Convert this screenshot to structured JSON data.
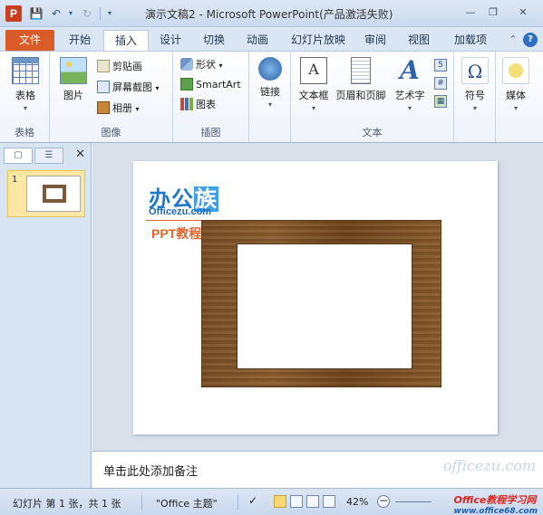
{
  "titlebar": {
    "app_icon": "P",
    "title": "演示文稿2 - Microsoft PowerPoint(产品激活失败)"
  },
  "tabs": [
    "文件",
    "开始",
    "插入",
    "设计",
    "切换",
    "动画",
    "幻灯片放映",
    "审阅",
    "视图",
    "加载项"
  ],
  "active_tab": "插入",
  "ribbon": {
    "groups": {
      "tables": {
        "label": "表格",
        "table_btn": "表格"
      },
      "images": {
        "label": "图像",
        "picture_btn": "图片",
        "clipart": "剪贴画",
        "screenshot": "屏幕截图",
        "album": "相册"
      },
      "illustrations": {
        "label": "插图",
        "shapes": "形状",
        "smartart": "SmartArt",
        "chart": "图表"
      },
      "links": {
        "link_btn": "链接"
      },
      "text": {
        "label": "文本",
        "textbox": "文本框",
        "header_footer": "页眉和页脚",
        "wordart": "艺术字"
      },
      "symbols": {
        "symbol_btn": "符号",
        "symbol_glyph": "Ω"
      },
      "media": {
        "media_btn": "媒体"
      }
    }
  },
  "left_panel": {
    "slide_number": "1"
  },
  "slide": {
    "logo_title_a": "办公",
    "logo_title_b": "族",
    "logo_url": "Officezu.com",
    "logo_sub": "PPT教程"
  },
  "notes": {
    "placeholder": "单击此处添加备注",
    "watermark": "officezu.com"
  },
  "statusbar": {
    "slide_info": "幻灯片 第 1 张，共 1 张",
    "theme": "\"Office 主题\"",
    "zoom": "42%",
    "site_a": "Office教程学习网",
    "site_b": "www.office68.com"
  },
  "colors": {
    "file_tab": "#d95b27",
    "accent": "#2f62a8",
    "wood": "#7a4f25"
  }
}
